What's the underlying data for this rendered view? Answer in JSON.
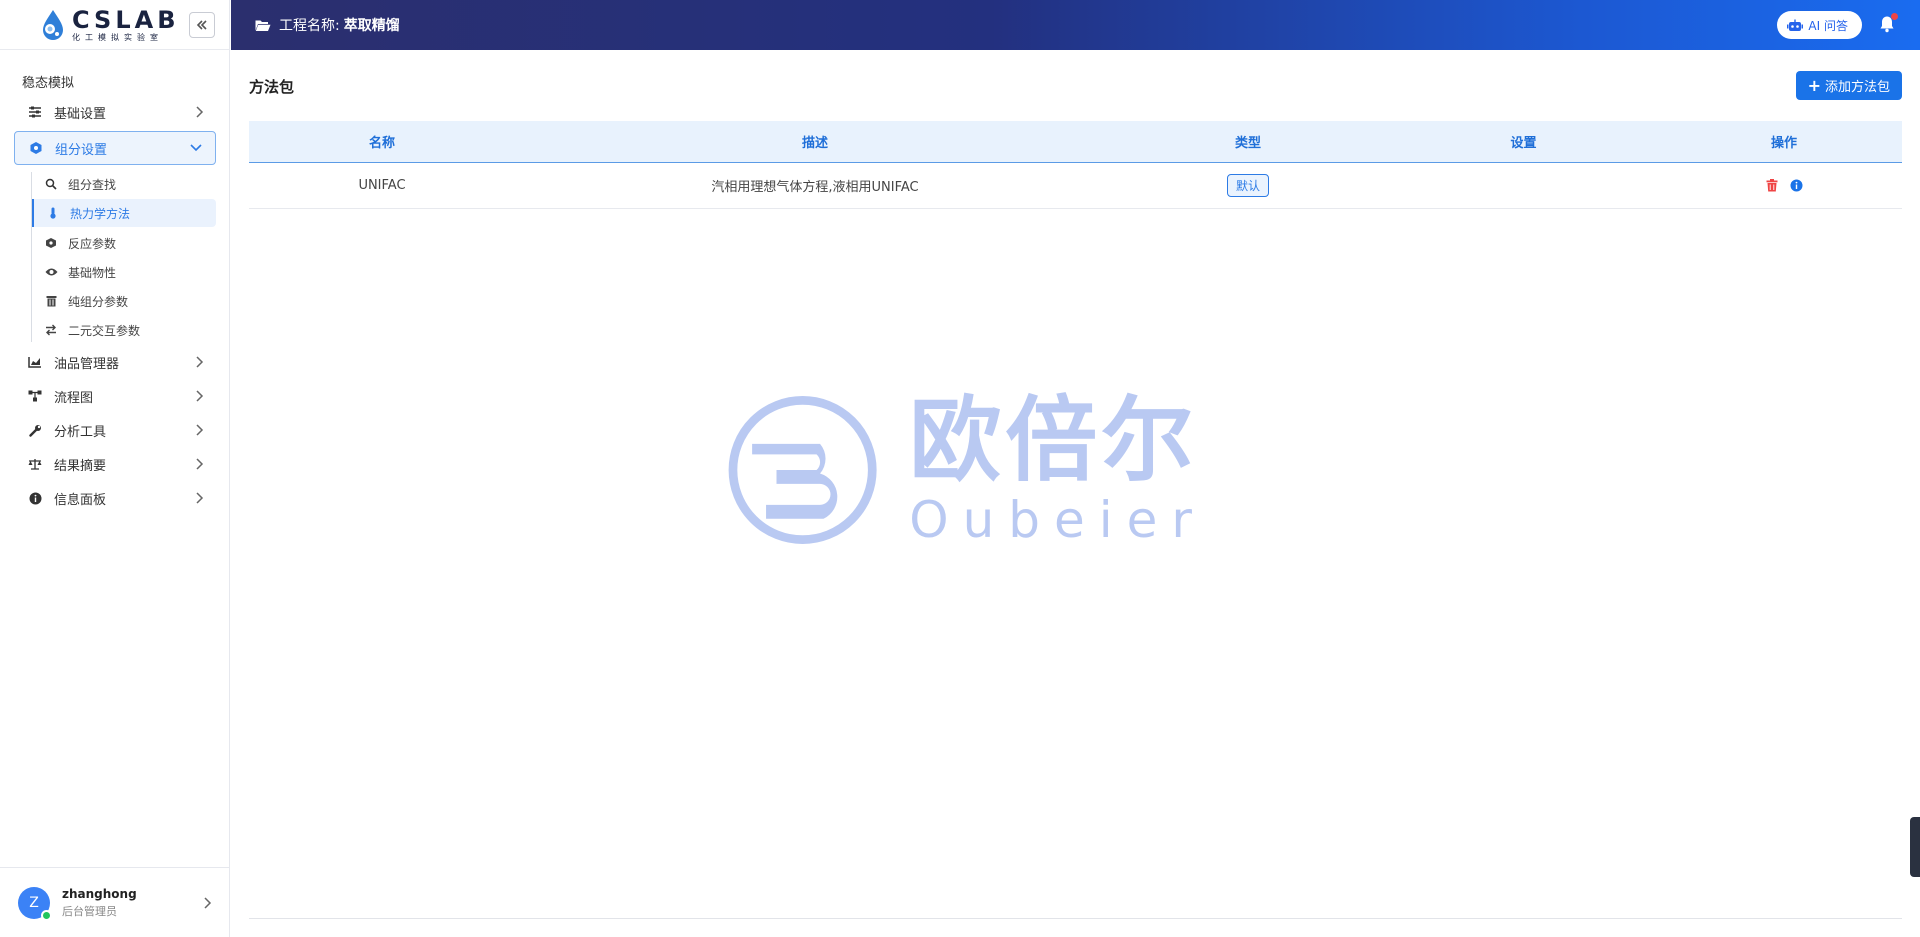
{
  "logo": {
    "main": "CSLAB",
    "sub": "化工模拟实验室"
  },
  "header": {
    "project_label": "工程名称:",
    "project_name": "萃取精馏",
    "ai_label": "AI 问答"
  },
  "sidebar": {
    "section_title": "稳态模拟",
    "items": [
      {
        "label": "基础设置",
        "icon": "sliders-icon"
      },
      {
        "label": "组分设置",
        "icon": "hexagon-icon",
        "active": true
      },
      {
        "label": "油品管理器",
        "icon": "chart-area-icon"
      },
      {
        "label": "流程图",
        "icon": "sitemap-icon"
      },
      {
        "label": "分析工具",
        "icon": "wrench-icon"
      },
      {
        "label": "结果摘要",
        "icon": "balance-scale-icon"
      },
      {
        "label": "信息面板",
        "icon": "info-icon"
      }
    ],
    "sub_items": [
      {
        "label": "组分查找",
        "icon": "search-icon"
      },
      {
        "label": "热力学方法",
        "icon": "thermometer-icon",
        "active": true
      },
      {
        "label": "反应参数",
        "icon": "cube-icon"
      },
      {
        "label": "基础物性",
        "icon": "eye-icon"
      },
      {
        "label": "纯组分参数",
        "icon": "trash-box-icon"
      },
      {
        "label": "二元交互参数",
        "icon": "exchange-icon"
      }
    ]
  },
  "user": {
    "initial": "Z",
    "name": "zhanghong",
    "role": "后台管理员"
  },
  "main": {
    "title": "方法包",
    "add_label": "添加方法包",
    "columns": [
      "名称",
      "描述",
      "类型",
      "设置",
      "操作"
    ],
    "rows": [
      {
        "name": "UNIFAC",
        "description": "汽相用理想气体方程,液相用UNIFAC",
        "type": "默认",
        "setting": ""
      }
    ]
  },
  "watermark": {
    "cn": "欧倍尔",
    "en": "Oubeier"
  },
  "colors": {
    "accent": "#1a73e8",
    "header_start": "#2b2f6e",
    "header_end": "#1a6cf0",
    "delete": "#ef4444"
  }
}
